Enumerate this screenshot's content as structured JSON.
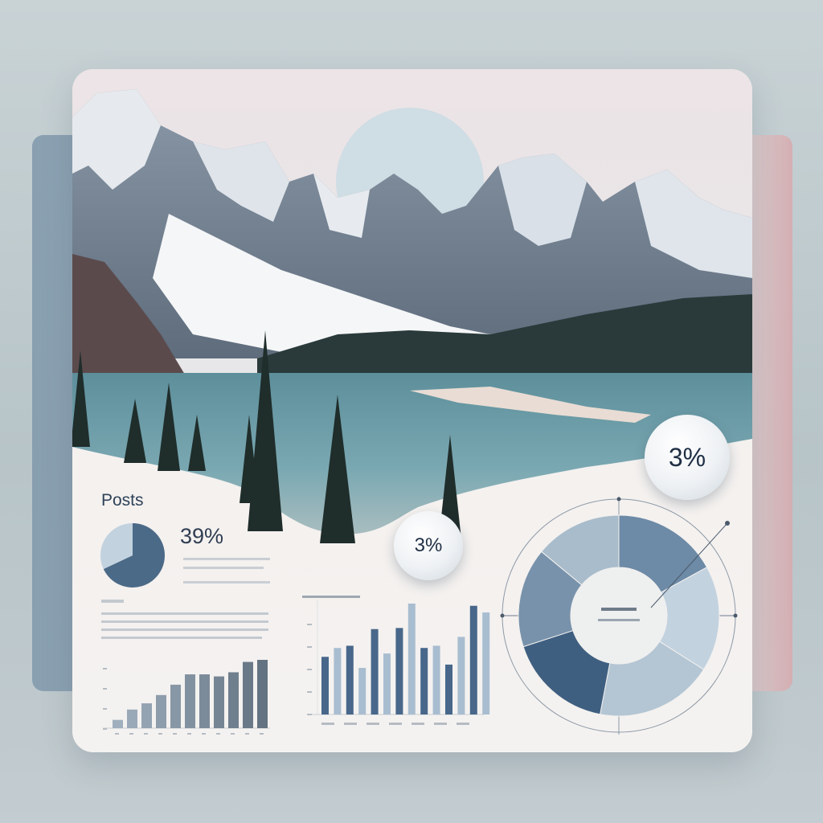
{
  "posts": {
    "title": "Posts",
    "percent": "39%"
  },
  "bubbles": {
    "large": "3%",
    "small": "3%"
  },
  "chart_data": [
    {
      "type": "pie",
      "values": [
        68,
        32
      ],
      "colors": [
        "#4b6a87",
        "#c2d2df"
      ]
    },
    {
      "type": "bar",
      "values": [
        4,
        9,
        12,
        16,
        21,
        26,
        26,
        25,
        27,
        32,
        33
      ]
    },
    {
      "type": "bar",
      "values": [
        52,
        60,
        62,
        42,
        77,
        55,
        78,
        100,
        60,
        62,
        45,
        70,
        98,
        92
      ]
    },
    {
      "type": "pie",
      "values": [
        17,
        17,
        19,
        17,
        16,
        14
      ],
      "colors": [
        "#6d8aa6",
        "#c3d2df",
        "#b4c6d4",
        "#3f5f80",
        "#7892ab",
        "#a9bccb"
      ]
    }
  ],
  "colors": {
    "accent": "#4b6a87",
    "text": "#2f4258"
  }
}
